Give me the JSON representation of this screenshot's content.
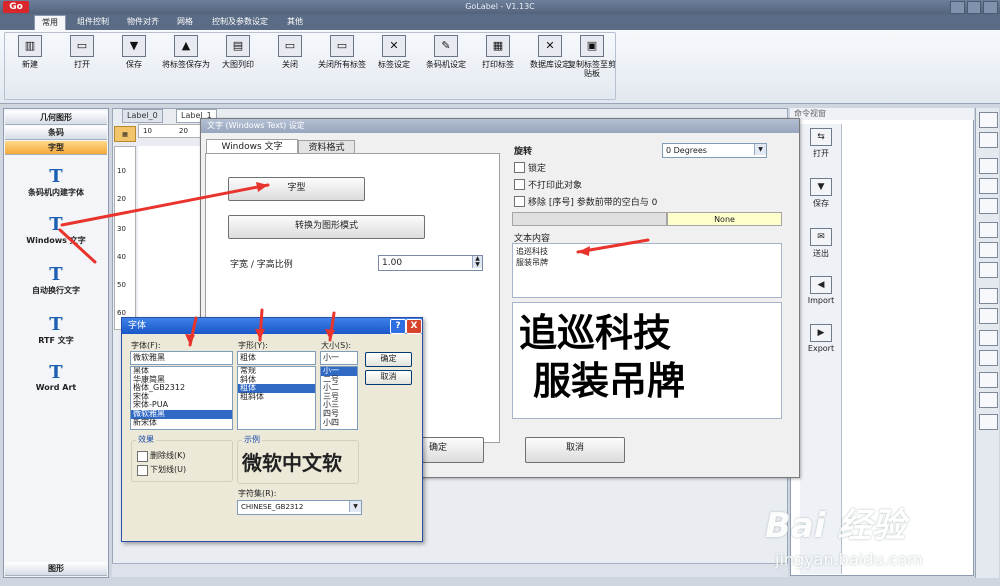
{
  "app": {
    "logo_text": "Go",
    "title": "GoLabel - V1.13C"
  },
  "ribbon": {
    "tabs": [
      "常用",
      "组件控制",
      "物件对齐",
      "网格",
      "控制及参数设定",
      "其他"
    ],
    "buttons": [
      {
        "label": "新建",
        "icon": "barcode-icon"
      },
      {
        "label": "打开",
        "icon": "folder-open-icon"
      },
      {
        "label": "保存",
        "icon": "save-icon"
      },
      {
        "label": "将标签保存为",
        "icon": "save-as-icon"
      },
      {
        "label": "大图列印",
        "icon": "print-preview-icon"
      },
      {
        "label": "关闭",
        "icon": "folder-icon"
      },
      {
        "label": "关闭所有标签",
        "icon": "close-all-icon"
      },
      {
        "label": "标签设定",
        "icon": "tools-icon"
      },
      {
        "label": "条码机设定",
        "icon": "printer-settings-icon"
      },
      {
        "label": "打印标签",
        "icon": "printer-icon"
      },
      {
        "label": "数据库设定",
        "icon": "database-icon"
      },
      {
        "label": "复制标签至剪贴板",
        "icon": "clipboard-icon"
      }
    ]
  },
  "left_panel": {
    "headers": [
      "几何图形",
      "条码",
      "字型"
    ],
    "bottom_header": "图形",
    "items": [
      "条码机内建字体",
      "Windows 文字",
      "自动换行文字",
      "RTF 文字",
      "Word Art"
    ]
  },
  "documents": {
    "tabs": [
      "Label_0",
      "Label_1"
    ],
    "ruler_top": [
      "10",
      "20"
    ],
    "ruler_left": [
      "10",
      "20",
      "30",
      "40",
      "50",
      "60"
    ]
  },
  "command_window": {
    "title": "命令视窗",
    "buttons": [
      "打开",
      "保存",
      "送出",
      "Import",
      "Export"
    ]
  },
  "text_dialog": {
    "title": "文字 (Windows Text) 设定",
    "tabs": [
      "Windows 文字",
      "资料格式"
    ],
    "font_button": "字型",
    "convert_button": "转换为图形模式",
    "ratio_label": "字宽 / 字高比例",
    "ratio_value": "1.00",
    "rotation_label": "旋转",
    "rotation_value": "0 Degrees",
    "checkbox_lock": "锁定",
    "checkbox_noprint": "不打印此对象",
    "checkbox_trim": "移除 [序号] 参数前带的空白与 0",
    "none_label": "None",
    "content_label": "文本内容",
    "content_lines": [
      "追巡科技",
      "服装吊牌"
    ],
    "preview_lines": [
      "追巡科技",
      "服装吊牌"
    ],
    "ok_button": "确定",
    "cancel_button": "取消"
  },
  "font_dialog": {
    "title": "字体",
    "help_button": "?",
    "close_button": "X",
    "font_label": "字体(F):",
    "font_value": "微软雅黑",
    "fonts": [
      "黑体",
      "华康简黑",
      "楷体_GB2312",
      "宋体",
      "宋体-PUA",
      "微软雅黑",
      "新宋体"
    ],
    "style_label": "字形(Y):",
    "style_value": "粗体",
    "styles": [
      "常规",
      "斜体",
      "粗体",
      "粗斜体"
    ],
    "size_label": "大小(S):",
    "size_value": "小一",
    "sizes": [
      "小一",
      "二号",
      "小二",
      "三号",
      "小三",
      "四号",
      "小四"
    ],
    "ok": "确定",
    "cancel": "取消",
    "effects_label": "效果",
    "strike_label": "删除线(K)",
    "underline_label": "下划线(U)",
    "sample_label": "示例",
    "sample_text": "微软中文软",
    "charset_label": "字符集(R):",
    "charset_value": "CHINESE_GB2312"
  },
  "watermark": {
    "brand": "Bai 经验",
    "url": "jingyan.baidu.com"
  },
  "colors": {
    "accent": "#d8262b",
    "ribbon_tab": "#5a6b85",
    "selection": "#316ac5",
    "arrow": "#e8342c"
  }
}
